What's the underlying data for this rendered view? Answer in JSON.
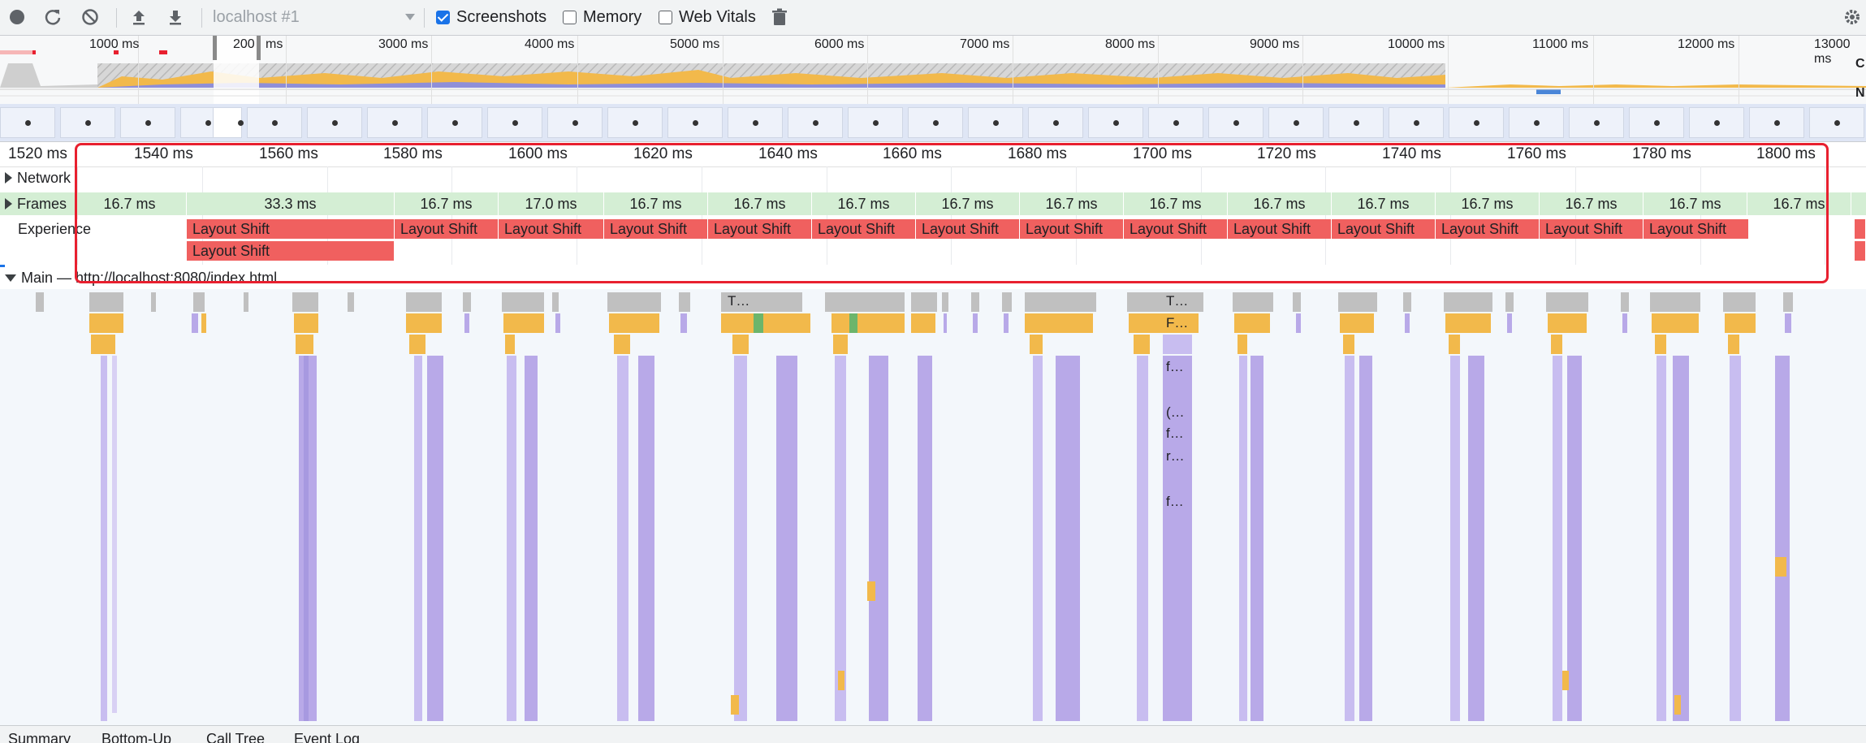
{
  "toolbar": {
    "page_select": "localhost #1",
    "screenshots_label": "Screenshots",
    "screenshots_checked": true,
    "memory_label": "Memory",
    "memory_checked": false,
    "web_vitals_label": "Web Vitals",
    "web_vitals_checked": false
  },
  "overview": {
    "ticks": [
      "1000 ms",
      "200",
      "ms",
      "3000 ms",
      "4000 ms",
      "5000 ms",
      "6000 ms",
      "7000 ms",
      "8000 ms",
      "9000 ms",
      "10000 ms",
      "11000 ms",
      "12000 ms",
      "13000 ms"
    ],
    "side_labels": [
      "C",
      "N"
    ]
  },
  "ruler": {
    "ticks": [
      "1520 ms",
      "1540 ms",
      "1560 ms",
      "1580 ms",
      "1600 ms",
      "1620 ms",
      "1640 ms",
      "1660 ms",
      "1680 ms",
      "1700 ms",
      "1720 ms",
      "1740 ms",
      "1760 ms",
      "1780 ms",
      "1800 ms"
    ]
  },
  "tracks": {
    "network": "Network",
    "frames": "Frames",
    "experience": "Experience",
    "main": "Main — http://localhost:8080/index.html"
  },
  "frames": [
    "16.7 ms",
    "33.3 ms",
    "16.7 ms",
    "17.0 ms",
    "16.7 ms",
    "16.7 ms",
    "16.7 ms",
    "16.7 ms",
    "16.7 ms",
    "16.7 ms",
    "16.7 ms",
    "16.7 ms",
    "16.7 ms",
    "16.7 ms",
    "16.7 ms",
    "16.7 ms"
  ],
  "layout_shift_label": "Layout Shift",
  "main_slices": [
    "T…",
    "T…",
    "F…",
    "f…",
    "(…",
    "f…",
    "r…",
    "f…"
  ],
  "bottom_tabs": [
    "Summary",
    "Bottom-Up",
    "Call Tree",
    "Event Log"
  ],
  "colors": {
    "scripting": "#f2b94b",
    "rendering": "#b8a9e8",
    "system": "#c0c0c0",
    "painting": "#6cb56b",
    "layout_shift": "#f0605f",
    "frame": "#d4eed4",
    "highlight": "#e8202f"
  }
}
